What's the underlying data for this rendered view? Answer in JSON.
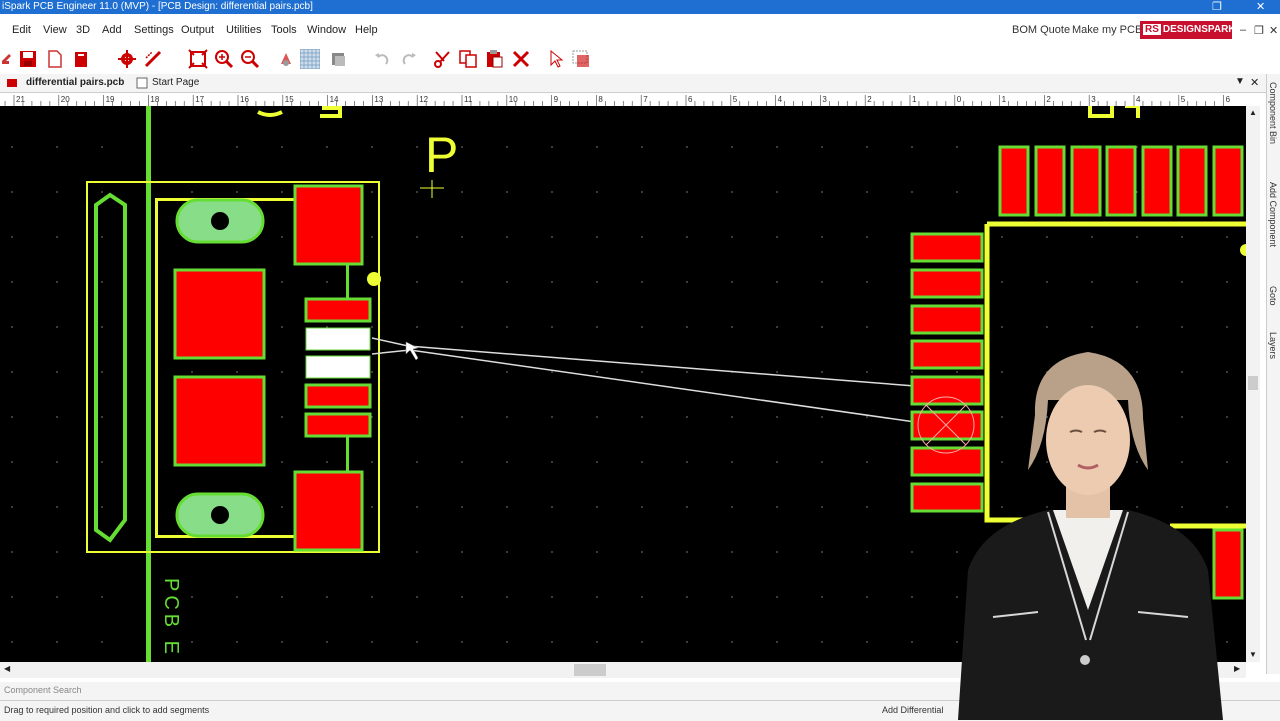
{
  "window": {
    "title": "iSpark PCB Engineer 11.0 (MVP) - [PCB Design: differential pairs.pcb]"
  },
  "menu": {
    "items": [
      "Edit",
      "View",
      "3D",
      "Add",
      "Settings",
      "Output",
      "Utilities",
      "Tools",
      "Window",
      "Help"
    ],
    "right_links": [
      "BOM Quote",
      "Make my PCB"
    ],
    "brand": "DESIGNSPARK",
    "brand_prefix": "RS"
  },
  "tabs": [
    "differential pairs.pcb",
    "Start Page"
  ],
  "ruler": {
    "ticks": [
      "21",
      "20",
      "19",
      "18",
      "17",
      "16",
      "15",
      "14",
      "13",
      "12",
      "11",
      "10",
      "9",
      "8",
      "7",
      "6",
      "5",
      "4",
      "3",
      "2",
      "1",
      "0",
      "1",
      "2",
      "3",
      "4",
      "5",
      "6",
      "7",
      "8"
    ]
  },
  "side_panel": [
    "Component Bin",
    "Add Component",
    "Goto",
    "Layers"
  ],
  "canvas": {
    "ref_label": "P",
    "silk_text": "PCB E",
    "colors": {
      "pad": "#ff0000",
      "outline": "#66dd33",
      "silkscreen": "#eeff33",
      "selected": "#ffffff"
    }
  },
  "search": {
    "label": "Component Search"
  },
  "status": {
    "hint": "Drag to required position and click to add segments",
    "mode": "Add Differential"
  }
}
